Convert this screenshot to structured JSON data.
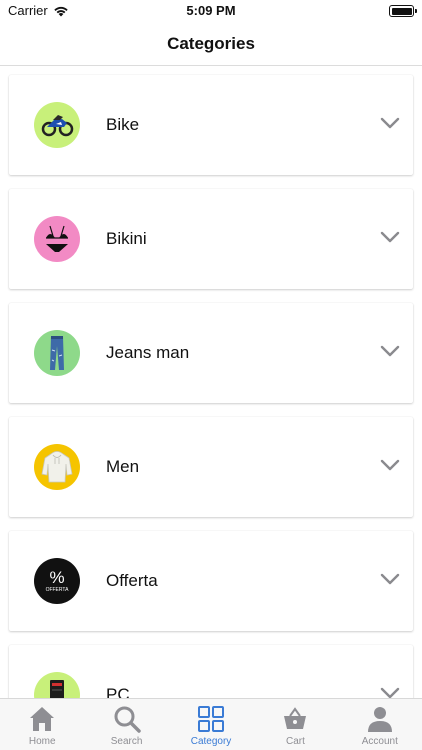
{
  "status_bar": {
    "carrier": "Carrier",
    "time": "5:09 PM"
  },
  "nav": {
    "title": "Categories"
  },
  "categories": [
    {
      "label": "Bike",
      "icon": "motorbike-icon",
      "bg": "#c8f07a"
    },
    {
      "label": "Bikini",
      "icon": "bikini-icon",
      "bg": "#f28ac4"
    },
    {
      "label": "Jeans man",
      "icon": "jeans-icon",
      "bg": "#8ed98a"
    },
    {
      "label": "Men",
      "icon": "hoodie-icon",
      "bg": "#f5c400"
    },
    {
      "label": "Offerta",
      "icon": "offerta-percent-icon",
      "bg": "#111111",
      "icon_text": "OFFERTA"
    },
    {
      "label": "PC",
      "icon": "pc-tower-icon",
      "bg": "#c8f07a"
    }
  ],
  "tabs": [
    {
      "label": "Home",
      "icon": "home-icon",
      "active": false
    },
    {
      "label": "Search",
      "icon": "search-icon",
      "active": false
    },
    {
      "label": "Category",
      "icon": "category-grid-icon",
      "active": true
    },
    {
      "label": "Cart",
      "icon": "basket-icon",
      "active": false
    },
    {
      "label": "Account",
      "icon": "person-icon",
      "active": false
    }
  ],
  "colors": {
    "accent": "#3a7bd5",
    "inactive": "#8e8e93",
    "chevron": "#8a8a8e"
  }
}
